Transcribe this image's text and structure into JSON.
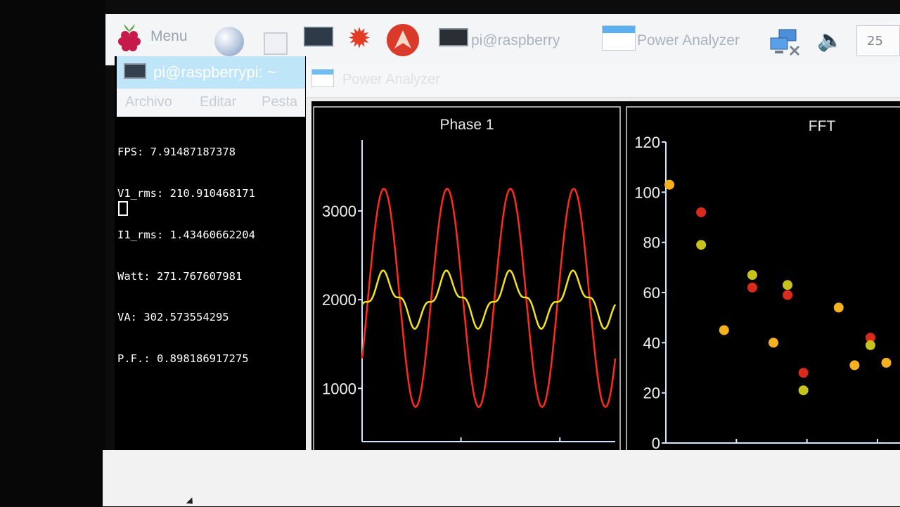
{
  "taskbar": {
    "menu_label": "Menu",
    "terminal_task_label": "pi@raspberry",
    "analyzer_task_label": "Power Analyzer",
    "zoom_value": "25"
  },
  "terminal": {
    "title": "pi@raspberrypi: ~",
    "menu": [
      "Archivo",
      "Editar",
      "Pesta"
    ],
    "lines": [
      "FPS: 7.91487187378",
      "V1_rms: 210.910468171",
      "I1_rms: 1.43460662204",
      "Watt: 271.767607981",
      "VA: 302.573554295",
      "P.F.: 0.898186917275"
    ]
  },
  "analyzer_window": {
    "title": "Power Analyzer"
  },
  "chart_data": [
    {
      "type": "line",
      "title": "Phase 1",
      "xlim": [
        0,
        256
      ],
      "ylim": [
        400,
        3800
      ],
      "xticks": [
        "0",
        "100",
        "200"
      ],
      "yticks": [
        "1000",
        "2000",
        "3000"
      ],
      "colors": {
        "voltage": "#ff2a1a",
        "current": "#f2e41c"
      },
      "series": [
        {
          "key": "voltage",
          "period": 64,
          "phase_of_peak": 22,
          "center": 2020,
          "amplitude": 1230
        },
        {
          "key": "current",
          "period": 64,
          "phase_of_peak": 22,
          "center": 2000,
          "amplitude": 330
        }
      ]
    },
    {
      "type": "scatter",
      "title": "FFT",
      "xlim": [
        0,
        600
      ],
      "ylim": [
        0,
        120
      ],
      "xticks": [
        "0",
        "200",
        "400",
        "60"
      ],
      "yticks": [
        "0",
        "20",
        "40",
        "60",
        "80",
        "100",
        "120"
      ],
      "colors": {
        "red": "#d92b1b",
        "yellow": "#c8c21c",
        "orange": "#f6b21e"
      },
      "points": [
        {
          "x": 10,
          "y": 103,
          "c": "orange"
        },
        {
          "x": 100,
          "y": 92,
          "c": "red"
        },
        {
          "x": 100,
          "y": 79,
          "c": "yellow"
        },
        {
          "x": 165,
          "y": 45,
          "c": "orange"
        },
        {
          "x": 245,
          "y": 67,
          "c": "yellow"
        },
        {
          "x": 245,
          "y": 62,
          "c": "red"
        },
        {
          "x": 305,
          "y": 40,
          "c": "orange"
        },
        {
          "x": 345,
          "y": 63,
          "c": "yellow"
        },
        {
          "x": 345,
          "y": 59,
          "c": "red"
        },
        {
          "x": 390,
          "y": 28,
          "c": "red"
        },
        {
          "x": 390,
          "y": 21,
          "c": "yellow"
        },
        {
          "x": 490,
          "y": 54,
          "c": "orange"
        },
        {
          "x": 535,
          "y": 31,
          "c": "orange"
        },
        {
          "x": 580,
          "y": 42,
          "c": "red"
        },
        {
          "x": 580,
          "y": 39,
          "c": "yellow"
        },
        {
          "x": 625,
          "y": 32,
          "c": "orange"
        }
      ]
    }
  ]
}
